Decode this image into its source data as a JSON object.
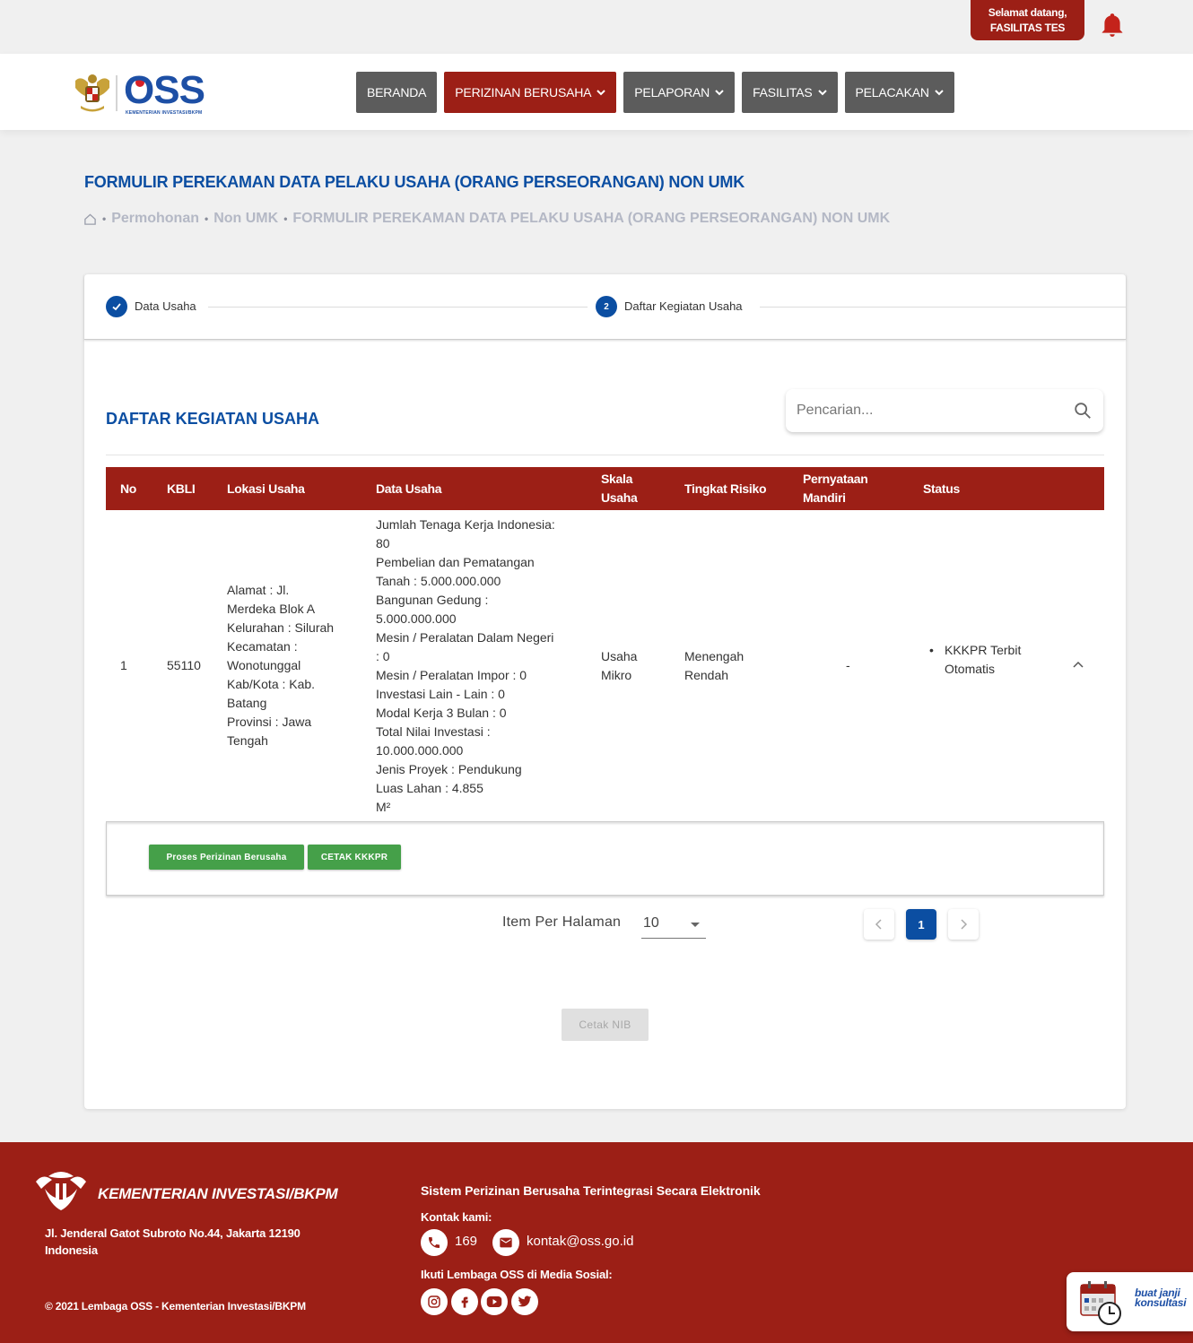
{
  "topbar": {
    "welcome_line1": "Selamat datang,",
    "welcome_line2": "FASILITAS TES"
  },
  "header": {
    "logo_text": "OSS",
    "logo_subtext": "KEMENTERIAN INVESTASI/BKPM",
    "nav": [
      {
        "label": "BERANDA",
        "dropdown": false
      },
      {
        "label": "PERIZINAN BERUSAHA",
        "dropdown": true,
        "active": true
      },
      {
        "label": "PELAPORAN",
        "dropdown": true
      },
      {
        "label": "FASILITAS",
        "dropdown": true
      },
      {
        "label": "PELACAKAN",
        "dropdown": true
      }
    ]
  },
  "page": {
    "title": "FORMULIR PEREKAMAN DATA PELAKU USAHA (ORANG PERSEORANGAN) NON UMK",
    "breadcrumb": [
      "Permohonan",
      "Non UMK",
      "FORMULIR PEREKAMAN DATA PELAKU USAHA (ORANG PERSEORANGAN) NON UMK"
    ]
  },
  "stepper": {
    "steps": [
      {
        "label": "Data Usaha",
        "state": "done"
      },
      {
        "number": "2",
        "label": "Daftar Kegiatan Usaha",
        "state": "active"
      }
    ]
  },
  "section": {
    "title": "DAFTAR KEGIATAN USAHA",
    "search_placeholder": "Pencarian..."
  },
  "table": {
    "headers": {
      "no": "No",
      "kbli": "KBLI",
      "lokasi": "Lokasi Usaha",
      "data": "Data Usaha",
      "skala": "Skala\nUsaha",
      "risiko": "Tingkat Risiko",
      "pernyataan": "Pernyataan\nMandiri",
      "status": "Status"
    },
    "rows": [
      {
        "no": "1",
        "kbli": "55110",
        "lokasi": "Alamat : Jl.\nMerdeka Blok A\nKelurahan : Silurah\nKecamatan :\nWonotunggal\nKab/Kota : Kab.\nBatang\nProvinsi : Jawa\nTengah",
        "data": "Jumlah Tenaga Kerja Indonesia:\n80\nPembelian dan Pematangan\nTanah : 5.000.000.000\nBangunan Gedung :\n5.000.000.000\nMesin / Peralatan Dalam Negeri\n: 0\nMesin / Peralatan Impor : 0\nInvestasi Lain - Lain : 0\nModal Kerja 3 Bulan : 0\nTotal Nilai Investasi :\n10.000.000.000\nJenis Proyek : Pendukung\nLuas Lahan : 4.855\nM²",
        "skala": "Usaha\nMikro",
        "risiko": "Menengah\nRendah",
        "pernyataan": "-",
        "status": "KKKPR Terbit\nOtomatis"
      }
    ],
    "actions": {
      "proses_label": "Proses Perizinan Berusaha",
      "cetak_kkkpr_label": "CETAK KKKPR"
    }
  },
  "pagination": {
    "items_per_page_label": "Item Per Halaman",
    "items_per_page_value": "10",
    "current_page": "1"
  },
  "cetak_nib_label": "Cetak NIB",
  "footer": {
    "org": "KEMENTERIAN INVESTASI/BKPM",
    "address": "Jl. Jenderal Gatot Subroto No.44, Jakarta 12190 Indonesia",
    "copyright": "© 2021 Lembaga OSS - Kementerian Investasi/BKPM",
    "system": "Sistem Perizinan Berusaha Terintegrasi Secara Elektronik",
    "contact_label": "Kontak kami:",
    "phone": "169",
    "email": "kontak@oss.go.id",
    "follow_label": "Ikuti Lembaga OSS di Media Sosial:"
  },
  "consult": {
    "line1": "buat janji",
    "line2": "konsultasi"
  },
  "colors": {
    "primary_red": "#9c1f16",
    "primary_blue": "#0b4ea2",
    "nav_gray": "#5c5c5c",
    "green": "#45a049"
  }
}
